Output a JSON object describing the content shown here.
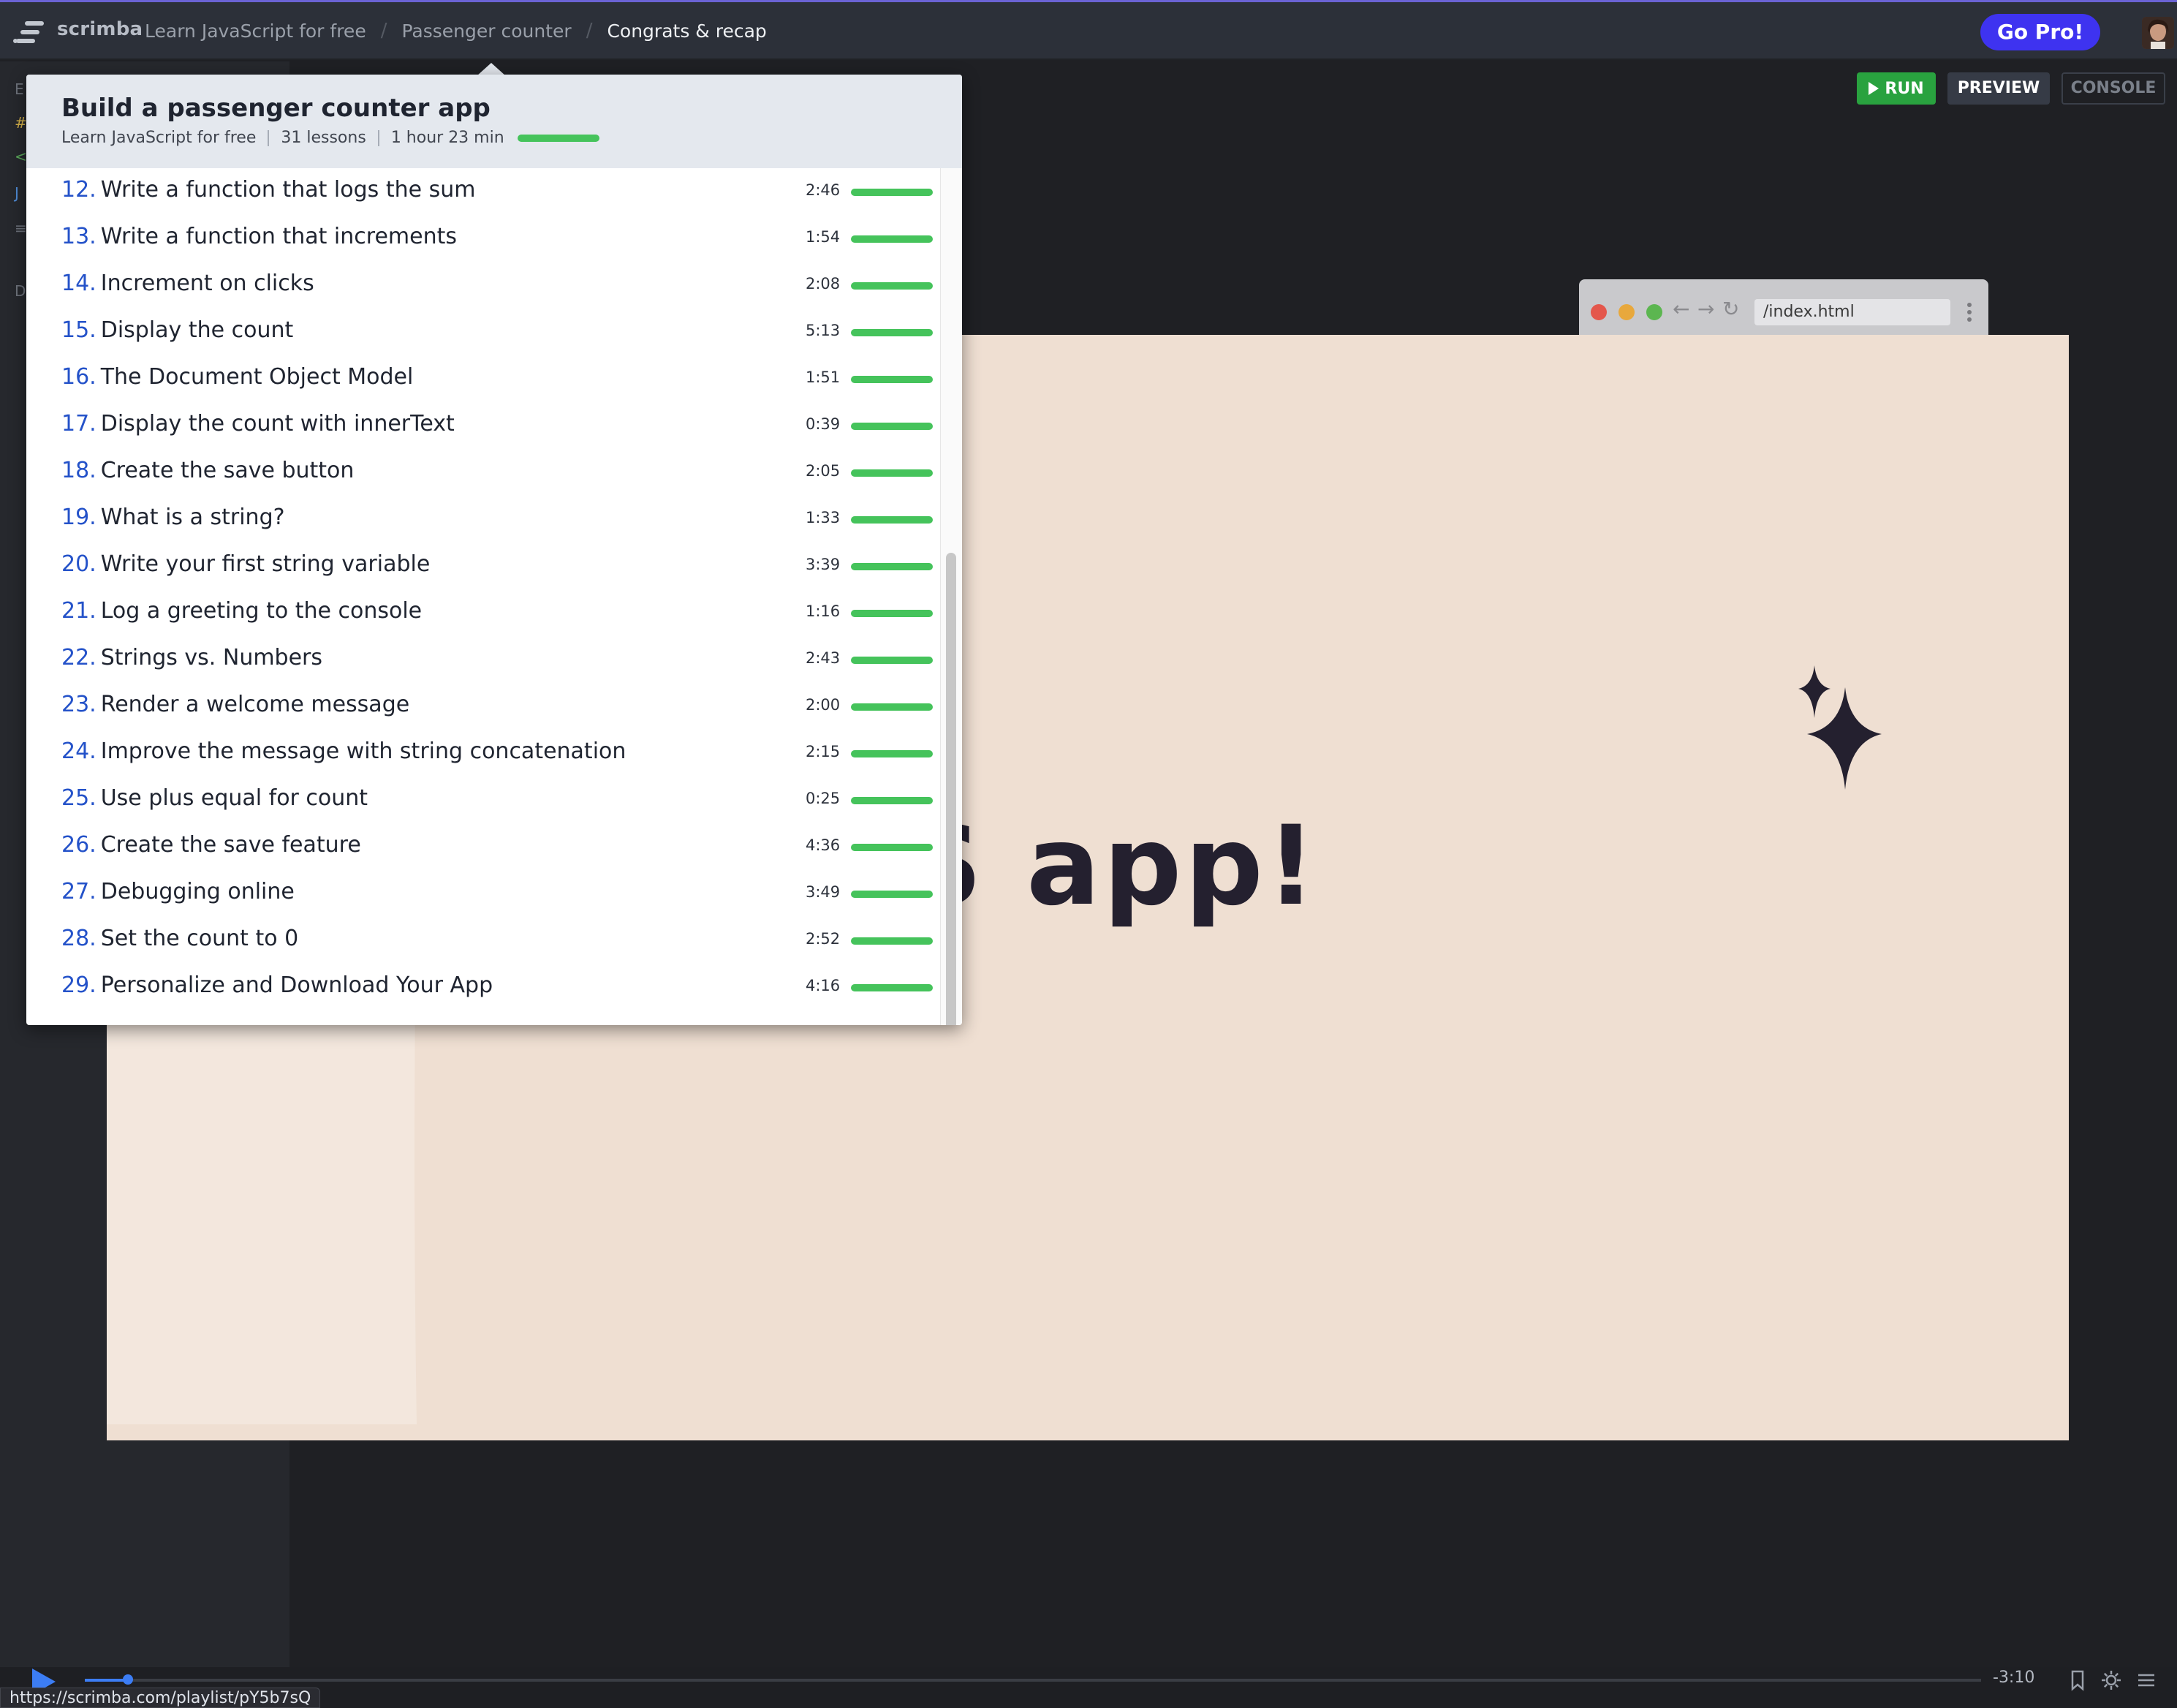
{
  "topbar": {
    "brand": "scrimba",
    "breadcrumbs": [
      "Learn JavaScript for free",
      "Passenger counter",
      "Congrats & recap"
    ],
    "gopro_label": "Go Pro!"
  },
  "editor": {
    "run_label": "RUN",
    "preview_label": "PREVIEW",
    "console_label": "CONSOLE"
  },
  "browser": {
    "address": "/index.html"
  },
  "slide": {
    "headline": "our first JS app!"
  },
  "playlist": {
    "title": "Build a passenger counter app",
    "course": "Learn JavaScript for free",
    "lesson_count": "31 lessons",
    "duration": "1 hour 23 min",
    "lessons": [
      {
        "num": "12.",
        "title": "Write a function that logs the sum",
        "duration": "2:46"
      },
      {
        "num": "13.",
        "title": "Write a function that increments",
        "duration": "1:54"
      },
      {
        "num": "14.",
        "title": "Increment on clicks",
        "duration": "2:08"
      },
      {
        "num": "15.",
        "title": "Display the count",
        "duration": "5:13"
      },
      {
        "num": "16.",
        "title": "The Document Object Model",
        "duration": "1:51"
      },
      {
        "num": "17.",
        "title": "Display the count with innerText",
        "duration": "0:39"
      },
      {
        "num": "18.",
        "title": "Create the save button",
        "duration": "2:05"
      },
      {
        "num": "19.",
        "title": "What is a string?",
        "duration": "1:33"
      },
      {
        "num": "20.",
        "title": "Write your first string variable",
        "duration": "3:39"
      },
      {
        "num": "21.",
        "title": "Log a greeting to the console",
        "duration": "1:16"
      },
      {
        "num": "22.",
        "title": "Strings vs. Numbers",
        "duration": "2:43"
      },
      {
        "num": "23.",
        "title": "Render a welcome message",
        "duration": "2:00"
      },
      {
        "num": "24.",
        "title": "Improve the message with string concatenation",
        "duration": "2:15"
      },
      {
        "num": "25.",
        "title": "Use plus equal for count",
        "duration": "0:25"
      },
      {
        "num": "26.",
        "title": "Create the save feature",
        "duration": "4:36"
      },
      {
        "num": "27.",
        "title": "Debugging online",
        "duration": "3:49"
      },
      {
        "num": "28.",
        "title": "Set the count to 0",
        "duration": "2:52"
      },
      {
        "num": "29.",
        "title": "Personalize and Download Your App",
        "duration": "4:16"
      }
    ]
  },
  "player": {
    "time_remaining": "-3:10",
    "status_url": "https://scrimba.com/playlist/pY5b7sQ"
  },
  "colors": {
    "accent": "#3e33f0",
    "progress": "#45c35b",
    "lesson_number": "#2452c9",
    "run": "#29a23f",
    "slide_bg": "#efdfd2"
  }
}
